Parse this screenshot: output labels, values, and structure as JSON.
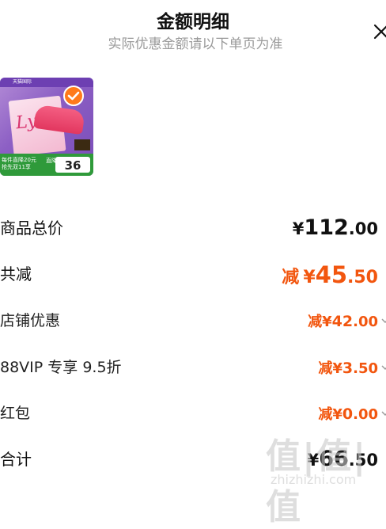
{
  "header": {
    "title": "金额明细",
    "subtitle": "实际优惠金额请以下单页为准"
  },
  "product": {
    "brand_text": "Lycée",
    "top_banner": "天猫国际",
    "bottom_label": "每件直降20元",
    "bottom_label2": "抢先双11享",
    "price_tag": "36",
    "price_tag_label": "直降"
  },
  "rows": {
    "total_price": {
      "label": "商品总价",
      "currency": "¥",
      "amount": "112",
      "decimal": ".00"
    },
    "total_discount": {
      "label": "共减",
      "prefix": "减",
      "currency": "¥",
      "amount": "45",
      "decimal": ".50"
    },
    "store_discount": {
      "label": "店铺优惠",
      "prefix": "减",
      "currency": "¥",
      "amount": "42",
      "decimal": ".00"
    },
    "vip_discount": {
      "label": "88VIP 专享 9.5折",
      "prefix": "减",
      "currency": "¥",
      "amount": "3",
      "decimal": ".50"
    },
    "red_packet": {
      "label": "红包",
      "prefix": "减",
      "currency": "¥",
      "amount": "0",
      "decimal": ".00"
    },
    "subtotal": {
      "label": "合计",
      "currency": "¥",
      "amount": "66",
      "decimal": ".50"
    }
  },
  "watermark": {
    "big": "值|值|值",
    "small": "zhizhizhi.com"
  },
  "colors": {
    "accent": "#f2560f",
    "subtitle": "#9a9a9a"
  },
  "icons": {
    "close": "close-icon",
    "chevron": "chevron-down-icon",
    "check": "check-icon"
  }
}
